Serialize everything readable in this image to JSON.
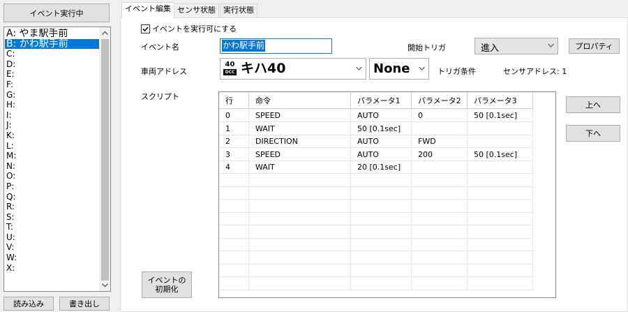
{
  "left_panel": {
    "running_button": "イベント実行中",
    "items": [
      {
        "label": "A: やま駅手前",
        "selected": false
      },
      {
        "label": "B: かわ駅手前",
        "selected": true
      },
      {
        "label": "C:",
        "selected": false
      },
      {
        "label": "D:",
        "selected": false
      },
      {
        "label": "E:",
        "selected": false
      },
      {
        "label": "F:",
        "selected": false
      },
      {
        "label": "G:",
        "selected": false
      },
      {
        "label": "H:",
        "selected": false
      },
      {
        "label": "I:",
        "selected": false
      },
      {
        "label": "J:",
        "selected": false
      },
      {
        "label": "K:",
        "selected": false
      },
      {
        "label": "L:",
        "selected": false
      },
      {
        "label": "M:",
        "selected": false
      },
      {
        "label": "N:",
        "selected": false
      },
      {
        "label": "O:",
        "selected": false
      },
      {
        "label": "P:",
        "selected": false
      },
      {
        "label": "Q:",
        "selected": false
      },
      {
        "label": "R:",
        "selected": false
      },
      {
        "label": "S:",
        "selected": false
      },
      {
        "label": "T:",
        "selected": false
      },
      {
        "label": "U:",
        "selected": false
      },
      {
        "label": "V:",
        "selected": false
      },
      {
        "label": "W:",
        "selected": false
      },
      {
        "label": "X:",
        "selected": false
      }
    ],
    "load_button": "読み込み",
    "save_button": "書き出し"
  },
  "tabs": [
    {
      "label": "イベント編集",
      "active": true
    },
    {
      "label": "センサ状態",
      "active": false
    },
    {
      "label": "実行状態",
      "active": false
    }
  ],
  "editor": {
    "enable_checkbox_label": "イベントを実行可にする",
    "enable_checked": true,
    "event_name_label": "イベント名",
    "event_name_value": "かわ駅手前",
    "start_trigger_label": "開始トリガ",
    "start_trigger_value": "進入",
    "property_button": "プロパティ",
    "vehicle_address_label": "車両アドレス",
    "vehicle_icon_number": "40",
    "vehicle_icon_tag": "DCC",
    "vehicle_value": "キハ40",
    "trigger_condition_value": "None",
    "trigger_condition_label": "トリガ条件",
    "sensor_address_text": "センサアドレス: 1",
    "script_label": "スクリプト",
    "up_button": "上へ",
    "down_button": "下へ",
    "init_button_line1": "イベントの",
    "init_button_line2": "初期化"
  },
  "script_table": {
    "columns": [
      "行",
      "命令",
      "パラメータ1",
      "パラメータ2",
      "パラメータ3"
    ],
    "rows": [
      [
        "0",
        "SPEED",
        "AUTO",
        "0",
        "50 [0.1sec]"
      ],
      [
        "1",
        "WAIT",
        "50 [0.1sec]",
        "",
        ""
      ],
      [
        "2",
        "DIRECTION",
        "AUTO",
        "FWD",
        ""
      ],
      [
        "3",
        "SPEED",
        "AUTO",
        "200",
        "50 [0.1sec]"
      ],
      [
        "4",
        "WAIT",
        "20 [0.1sec]",
        "",
        ""
      ]
    ],
    "empty_rows": 9
  },
  "icons": {
    "checkbox": "checkbox-checked-icon",
    "scroll_up": "chevron-up-icon",
    "scroll_down": "chevron-down-icon",
    "dropdown": "chevron-down-icon",
    "vehicle": "dcc-locomotive-icon"
  },
  "colors": {
    "selection": "#0078d7",
    "window_bg": "#f0f0f0",
    "field_focus_border": "#0078d7"
  }
}
